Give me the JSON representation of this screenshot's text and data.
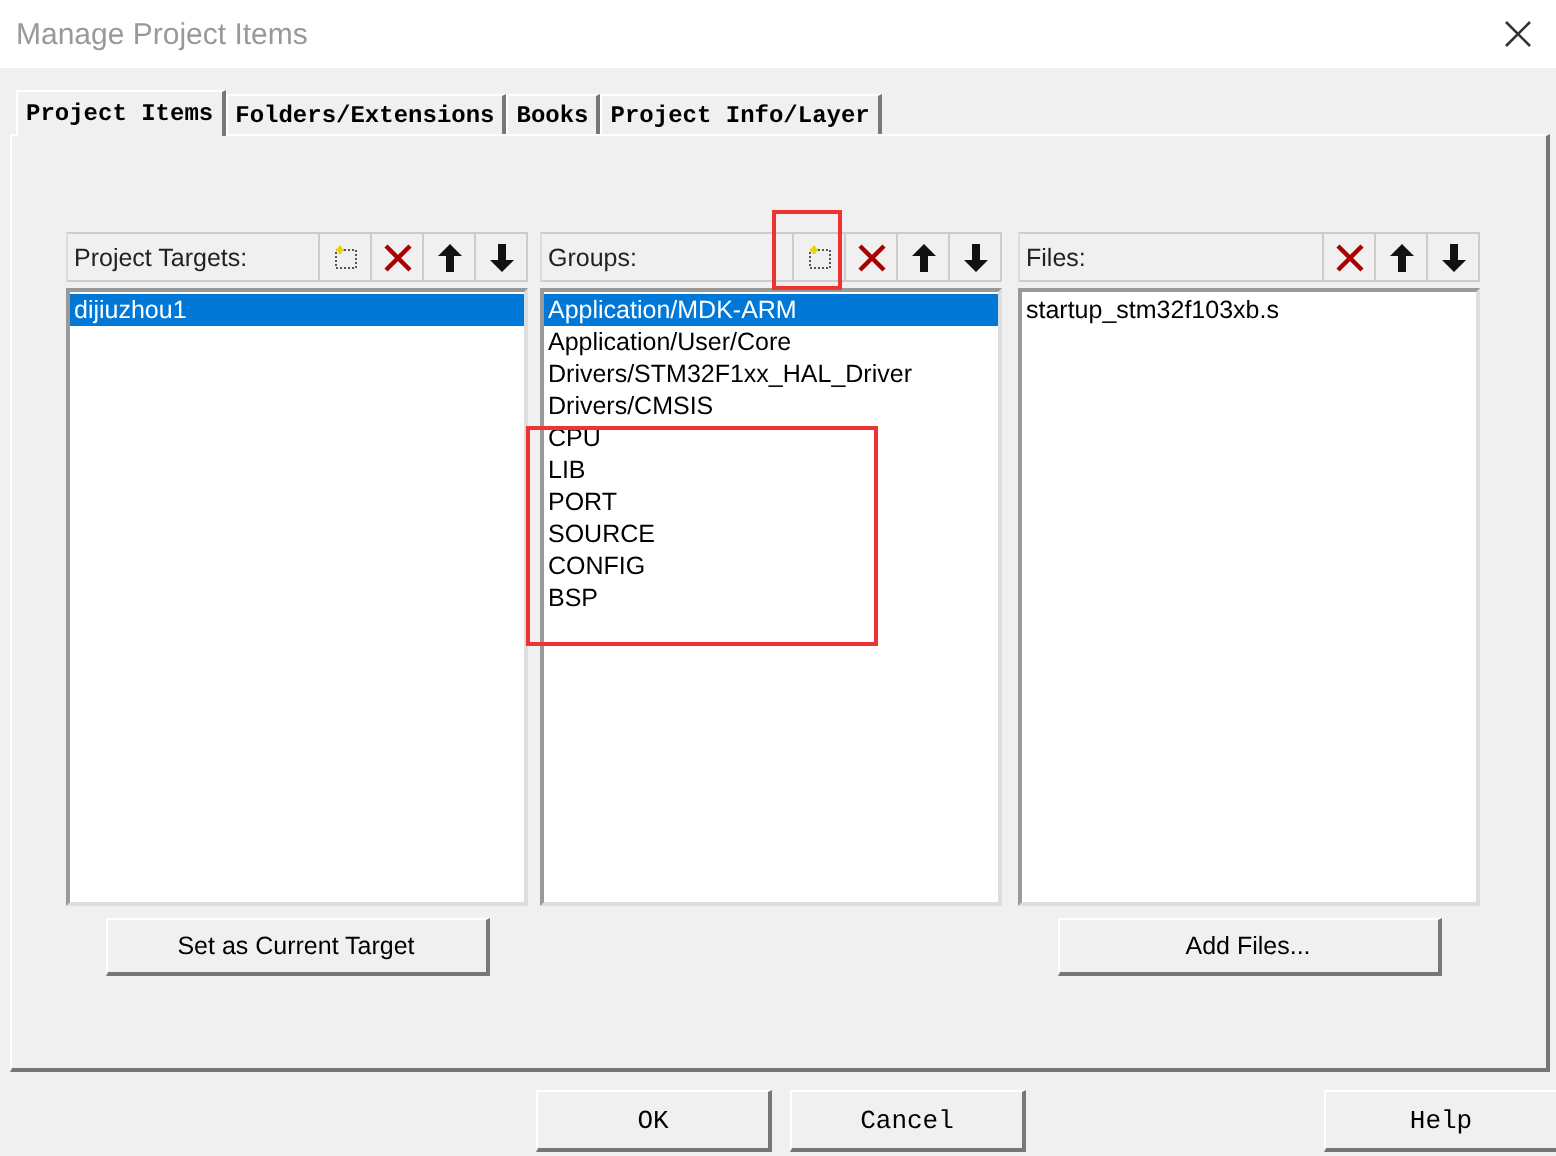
{
  "window": {
    "title": "Manage Project Items"
  },
  "tabs": [
    {
      "label": "Project Items",
      "selected": true
    },
    {
      "label": "Folders/Extensions",
      "selected": false
    },
    {
      "label": "Books",
      "selected": false
    },
    {
      "label": "Project Info/Layer",
      "selected": false
    }
  ],
  "panels": [
    {
      "title": "Project Targets:",
      "tools": [
        {
          "kind": "new"
        },
        {
          "kind": "delete"
        },
        {
          "kind": "up"
        },
        {
          "kind": "down"
        }
      ],
      "items": [
        {
          "label": "dijiuzhou1",
          "selected": true
        }
      ],
      "button": "Set as Current Target"
    },
    {
      "title": "Groups:",
      "tools": [
        {
          "kind": "new"
        },
        {
          "kind": "delete"
        },
        {
          "kind": "up"
        },
        {
          "kind": "down"
        }
      ],
      "items": [
        {
          "label": "Application/MDK-ARM",
          "selected": true
        },
        {
          "label": "Application/User/Core",
          "selected": false
        },
        {
          "label": "Drivers/STM32F1xx_HAL_Driver",
          "selected": false
        },
        {
          "label": "Drivers/CMSIS",
          "selected": false
        },
        {
          "label": "CPU",
          "selected": false
        },
        {
          "label": "LIB",
          "selected": false
        },
        {
          "label": "PORT",
          "selected": false
        },
        {
          "label": "SOURCE",
          "selected": false
        },
        {
          "label": "CONFIG",
          "selected": false
        },
        {
          "label": "BSP",
          "selected": false
        }
      ]
    },
    {
      "title": "Files:",
      "tools": [
        {
          "kind": "delete"
        },
        {
          "kind": "up"
        },
        {
          "kind": "down"
        }
      ],
      "items": [
        {
          "label": "startup_stm32f103xb.s",
          "selected": false
        }
      ],
      "button": "Add Files..."
    }
  ],
  "buttons": [
    "OK",
    "Cancel",
    "Help"
  ]
}
